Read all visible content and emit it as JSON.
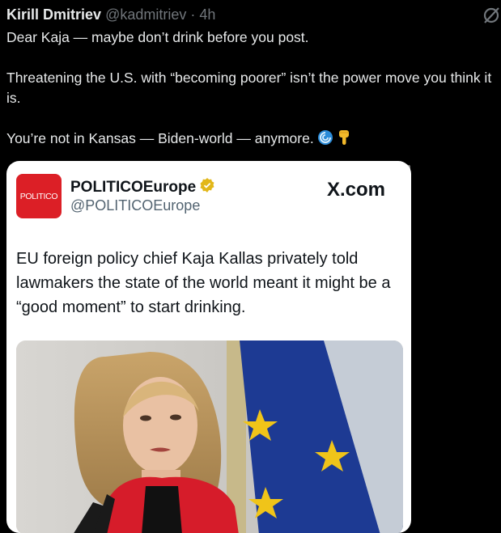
{
  "post": {
    "author_name": "Kirill Dmitriev",
    "author_handle": "@kadmitriev",
    "separator": "·",
    "time": "4h",
    "paragraphs": [
      "Dear Kaja — maybe don’t drink before you post.",
      "Threatening the U.S. with “becoming poorer” isn’t the power move you think it is.",
      "You’re not in Kansas — Biden-world — anymore."
    ],
    "emojis": [
      "cyclone-emoji",
      "pointing-down-emoji"
    ]
  },
  "quoted_card": {
    "logo_text": "POLITICO",
    "name": "POLITICOEurope",
    "handle": "@POLITICOEurope",
    "site": "X.com",
    "text": "EU foreign policy chief Kaja Kallas privately told lawmakers the state of the world meant it might be a “good moment” to start drinking."
  },
  "colors": {
    "background": "#000000",
    "text": "#e7e9ea",
    "muted": "#71767b",
    "politico_red": "#dc1f26",
    "verified_gold": "#e2b719",
    "card_background": "#ffffff"
  }
}
